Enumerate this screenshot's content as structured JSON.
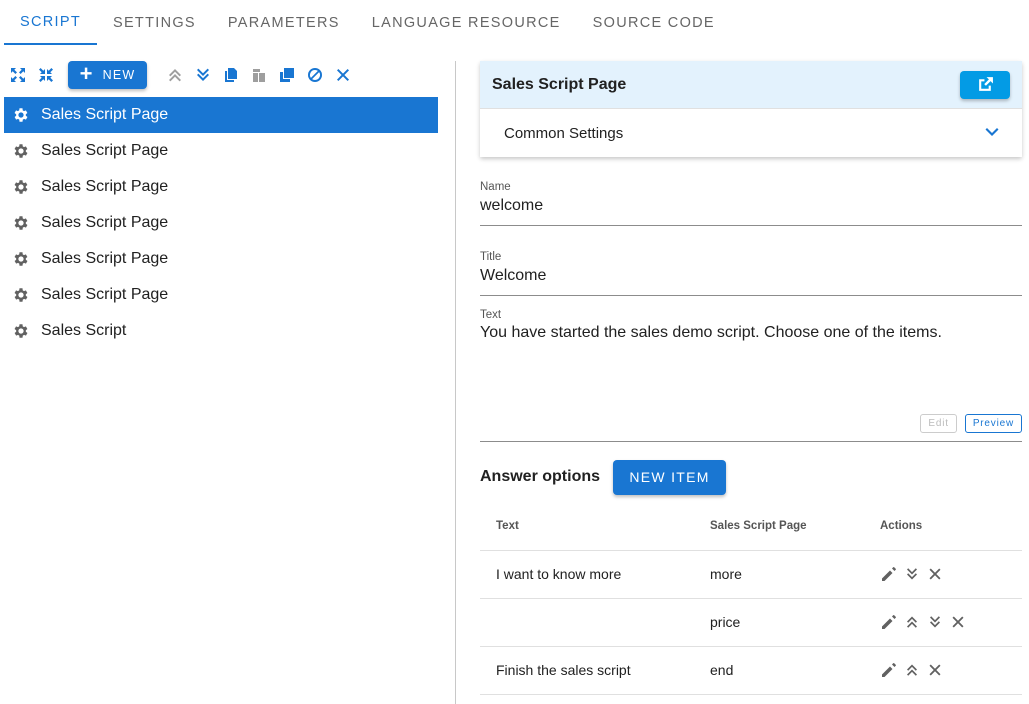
{
  "tabs": [
    {
      "label": "Script",
      "active": true
    },
    {
      "label": "Settings",
      "active": false
    },
    {
      "label": "Parameters",
      "active": false
    },
    {
      "label": "Language Resource",
      "active": false
    },
    {
      "label": "Source Code",
      "active": false
    }
  ],
  "toolbar": {
    "new_label": "NEW",
    "icons": [
      "expand-icon",
      "collapse-icon",
      "move-up-icon",
      "move-down-icon",
      "copy-icon",
      "paste-icon",
      "duplicate-icon",
      "disable-icon",
      "delete-icon"
    ]
  },
  "tree": {
    "items": [
      {
        "label": "Sales Script Page",
        "selected": true
      },
      {
        "label": "Sales Script Page",
        "selected": false
      },
      {
        "label": "Sales Script Page",
        "selected": false
      },
      {
        "label": "Sales Script Page",
        "selected": false
      },
      {
        "label": "Sales Script Page",
        "selected": false
      },
      {
        "label": "Sales Script Page",
        "selected": false
      },
      {
        "label": "Sales Script",
        "selected": false
      }
    ]
  },
  "panel": {
    "title": "Sales Script Page",
    "subheader": "Common Settings"
  },
  "form": {
    "name_label": "Name",
    "name_value": "welcome",
    "title_label": "Title",
    "title_value": "Welcome",
    "text_label": "Text",
    "text_value": "You have started the sales demo script. Choose one of the items.",
    "edit_label": "Edit",
    "preview_label": "Preview"
  },
  "answers": {
    "title": "Answer options",
    "new_item_label": "NEW ITEM",
    "columns": [
      "Text",
      "Sales Script Page",
      "Actions"
    ],
    "rows": [
      {
        "text": "I want to know more",
        "page": "more",
        "actions": [
          "edit",
          "down",
          "delete"
        ]
      },
      {
        "text": "",
        "page": "price",
        "actions": [
          "edit",
          "up",
          "down",
          "delete"
        ]
      },
      {
        "text": "Finish the sales script",
        "page": "end",
        "actions": [
          "edit",
          "up",
          "delete"
        ]
      }
    ]
  },
  "colors": {
    "primary": "#1976d2",
    "panel_header_bg": "#e3f2fd",
    "external_button": "#039be5"
  }
}
